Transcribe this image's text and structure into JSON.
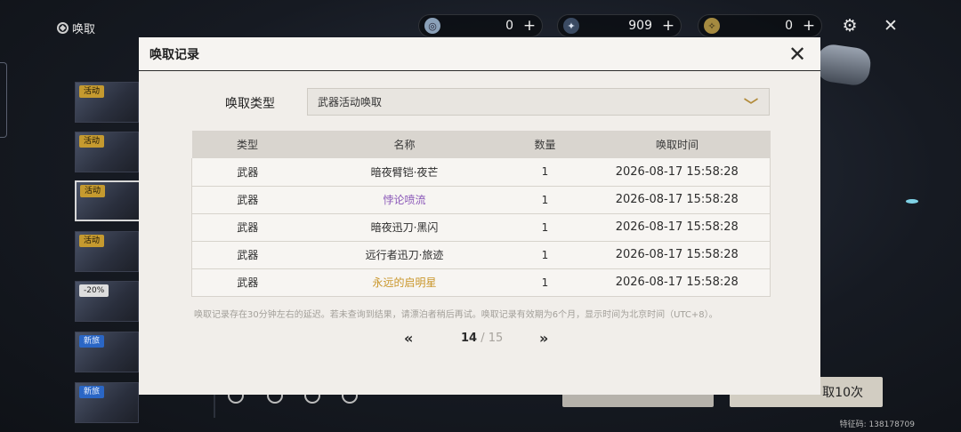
{
  "topbar": {
    "title": "唤取",
    "currencies": [
      {
        "icon": "lunite-icon",
        "value": "0",
        "plus": "+"
      },
      {
        "icon": "star-tide-icon",
        "value": "909",
        "plus": "+"
      },
      {
        "icon": "forging-tide-icon",
        "value": "0",
        "plus": "+"
      }
    ]
  },
  "sidebar": {
    "banners": [
      {
        "tag": "活动"
      },
      {
        "tag": "活动"
      },
      {
        "tag": "活动"
      },
      {
        "tag": "活动"
      },
      {
        "tag": "-20%"
      },
      {
        "tag": "新旅"
      },
      {
        "tag": "新旅"
      }
    ]
  },
  "actions": {
    "pull10_label": "取10次"
  },
  "uid_text": "特征码: 138178709",
  "dialog": {
    "title": "唤取记录",
    "filter_label": "唤取类型",
    "filter_value": "武器活动唤取",
    "columns": [
      "类型",
      "名称",
      "数量",
      "唤取时间"
    ],
    "rows": [
      {
        "type": "武器",
        "name": "暗夜臂铠·夜芒",
        "qty": "1",
        "time": "2026-08-17 15:58:28",
        "rarity": "normal"
      },
      {
        "type": "武器",
        "name": "悖论喷流",
        "qty": "1",
        "time": "2026-08-17 15:58:28",
        "rarity": "purple"
      },
      {
        "type": "武器",
        "name": "暗夜迅刀·黑闪",
        "qty": "1",
        "time": "2026-08-17 15:58:28",
        "rarity": "normal"
      },
      {
        "type": "武器",
        "name": "远行者迅刀·旅迹",
        "qty": "1",
        "time": "2026-08-17 15:58:28",
        "rarity": "normal"
      },
      {
        "type": "武器",
        "name": "永远的启明星",
        "qty": "1",
        "time": "2026-08-17 15:58:28",
        "rarity": "gold"
      }
    ],
    "note": "唤取记录存在30分钟左右的延迟。若未查询到结果，请漂泊者稍后再试。唤取记录有效期为6个月，显示时间为北京时间（UTC+8）。",
    "pager": {
      "prev": "«",
      "current": "14",
      "separator": "/",
      "total": "15",
      "next": "»"
    }
  },
  "colors": {
    "purple": "#8a57b8",
    "gold": "#c9962a",
    "accent": "#b28b3a"
  }
}
